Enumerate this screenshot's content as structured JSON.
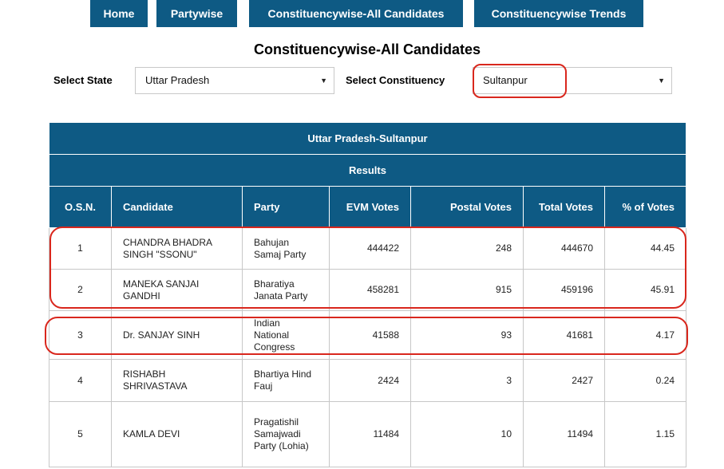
{
  "nav": {
    "home": "Home",
    "partywise": "Partywise",
    "constituency_all": "Constituencywise-All Candidates",
    "constituency_trends": "Constituencywise Trends"
  },
  "page_title": "Constituencywise-All Candidates",
  "filters": {
    "state_label": "Select State",
    "state_value": "Uttar Pradesh",
    "constituency_label": "Select Constituency",
    "constituency_value": "Sultanpur"
  },
  "table": {
    "caption": "Uttar Pradesh-Sultanpur",
    "subcaption": "Results",
    "columns": [
      "O.S.N.",
      "Candidate",
      "Party",
      "EVM Votes",
      "Postal Votes",
      "Total Votes",
      "% of Votes"
    ],
    "rows": [
      {
        "osn": "1",
        "candidate": "CHANDRA BHADRA SINGH \"SSONU\"",
        "party": "Bahujan Samaj Party",
        "evm": "444422",
        "postal": "248",
        "total": "444670",
        "pct": "44.45"
      },
      {
        "osn": "2",
        "candidate": "MANEKA SANJAI GANDHI",
        "party": "Bharatiya Janata Party",
        "evm": "458281",
        "postal": "915",
        "total": "459196",
        "pct": "45.91"
      },
      {
        "osn": "3",
        "candidate": "Dr. SANJAY SINH",
        "party": "Indian National Congress",
        "evm": "41588",
        "postal": "93",
        "total": "41681",
        "pct": "4.17"
      },
      {
        "osn": "4",
        "candidate": "RISHABH SHRIVASTAVA",
        "party": "Bhartiya Hind Fauj",
        "evm": "2424",
        "postal": "3",
        "total": "2427",
        "pct": "0.24"
      },
      {
        "osn": "5",
        "candidate": "KAMLA DEVI",
        "party": "Pragatishil Samajwadi Party (Lohia)",
        "evm": "11484",
        "postal": "10",
        "total": "11494",
        "pct": "1.15"
      }
    ]
  },
  "colors": {
    "header_bg": "#0e5a84",
    "highlight": "#d9271d"
  }
}
